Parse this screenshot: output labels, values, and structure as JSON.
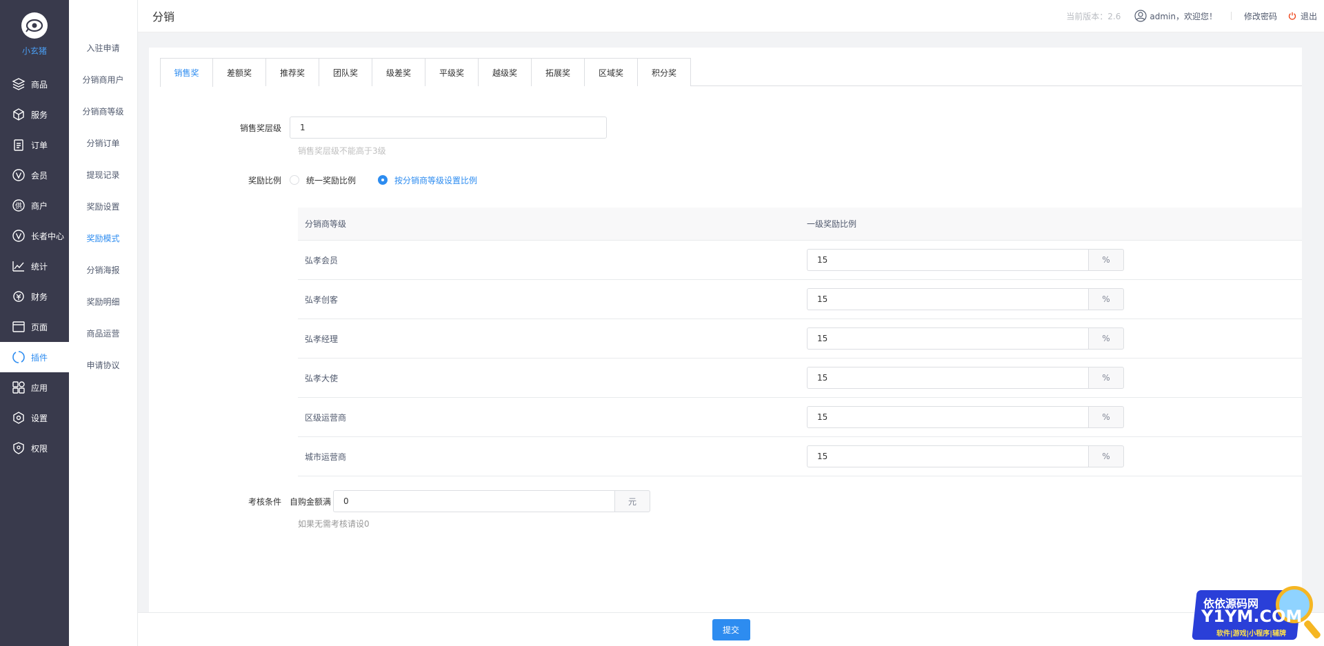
{
  "app": {
    "logo_text": "小玄猪"
  },
  "nav": [
    {
      "label": "商品",
      "icon": "layers-icon"
    },
    {
      "label": "服务",
      "icon": "box-icon"
    },
    {
      "label": "订单",
      "icon": "clipboard-icon"
    },
    {
      "label": "会员",
      "icon": "v-circle-icon"
    },
    {
      "label": "商户",
      "icon": "supply-circle-icon"
    },
    {
      "label": "长者中心",
      "icon": "v-circle-icon"
    },
    {
      "label": "统计",
      "icon": "line-chart-icon"
    },
    {
      "label": "财务",
      "icon": "finance-icon"
    },
    {
      "label": "页面",
      "icon": "browser-icon"
    },
    {
      "label": "插件",
      "icon": "plugin-icon",
      "active": true
    },
    {
      "label": "应用",
      "icon": "apps-icon"
    },
    {
      "label": "设置",
      "icon": "settings-icon"
    },
    {
      "label": "权限",
      "icon": "shield-icon"
    }
  ],
  "submenu": [
    {
      "label": "入驻申请"
    },
    {
      "label": "分销商用户"
    },
    {
      "label": "分销商等级"
    },
    {
      "label": "分销订单"
    },
    {
      "label": "提现记录"
    },
    {
      "label": "奖励设置"
    },
    {
      "label": "奖励模式",
      "active": true
    },
    {
      "label": "分销海报"
    },
    {
      "label": "奖励明细"
    },
    {
      "label": "商品运营"
    },
    {
      "label": "申请协议"
    }
  ],
  "header": {
    "title": "分销",
    "version": "当前版本：2.6",
    "welcome": "admin，欢迎您！",
    "change_password": "修改密码",
    "logout": "退出"
  },
  "tabs": [
    "销售奖",
    "差额奖",
    "推荐奖",
    "团队奖",
    "级差奖",
    "平级奖",
    "越级奖",
    "拓展奖",
    "区域奖",
    "积分奖"
  ],
  "active_tab": 0,
  "form": {
    "level_label": "销售奖层级",
    "level_value": "1",
    "level_hint": "销售奖层级不能高于3级",
    "ratio_label": "奖励比例",
    "ratio_options": [
      "统一奖励比例",
      "按分销商等级设置比例"
    ],
    "ratio_selected": 1,
    "table": {
      "headers": [
        "分销商等级",
        "一级奖励比例"
      ],
      "unit": "%",
      "rows": [
        {
          "level": "弘孝会员",
          "value": "15"
        },
        {
          "level": "弘孝创客",
          "value": "15"
        },
        {
          "level": "弘孝经理",
          "value": "15"
        },
        {
          "level": "弘孝大使",
          "value": "15"
        },
        {
          "level": "区级运营商",
          "value": "15"
        },
        {
          "level": "城市运营商",
          "value": "15"
        }
      ]
    },
    "assess_label": "考核条件",
    "assess_prefix": "自购金额满",
    "assess_value": "0",
    "assess_unit": "元",
    "assess_hint": "如果无需考核请设0",
    "submit": "提交"
  },
  "watermark": {
    "line1": "依依源码网",
    "line2": "Y1YM.COM",
    "line3": "软件|游戏|小程序|辅牌"
  },
  "colors": {
    "sidebar": "#393a4c",
    "accent": "#2d8cf0"
  }
}
